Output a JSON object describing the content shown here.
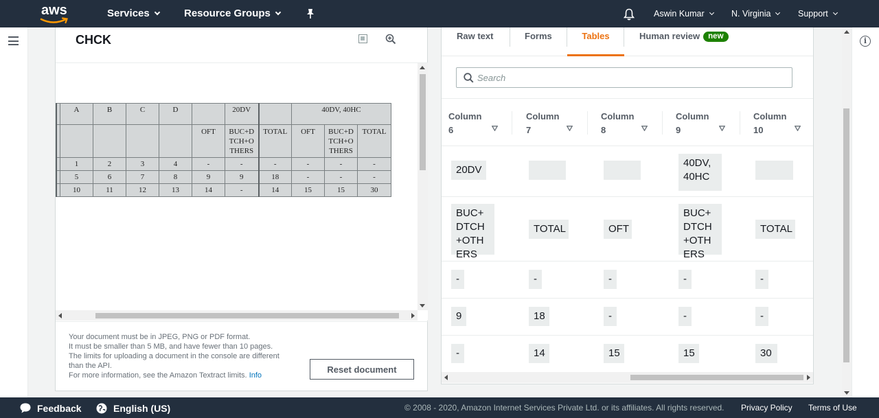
{
  "topnav": {
    "logo": "aws",
    "services": "Services",
    "resource_groups": "Resource Groups",
    "pin_icon": "pin-icon",
    "bell_icon": "bell-icon",
    "user": "Aswin Kumar",
    "region": "N. Virginia",
    "support": "Support"
  },
  "doc": {
    "title": "CHCK",
    "scan_table": {
      "row0": [
        "A",
        "B",
        "C",
        "D",
        "",
        "20DV",
        "",
        "40DV, 40HC"
      ],
      "row1": [
        "",
        "",
        "",
        "",
        "OFT",
        "BUC+D TCH+O THERS",
        "TOTAL",
        "OFT",
        "BUC+D TCH+O THERS",
        "TOTAL"
      ],
      "rows": [
        [
          "1",
          "2",
          "3",
          "4",
          "-",
          "-",
          "-",
          "-",
          "-",
          "-"
        ],
        [
          "5",
          "6",
          "7",
          "8",
          "9",
          "9",
          "18",
          "-",
          "-",
          "-"
        ],
        [
          "10",
          "11",
          "12",
          "13",
          "14",
          "-",
          "14",
          "15",
          "15",
          "30"
        ]
      ]
    },
    "notes": [
      "Your document must be in JPEG, PNG or PDF format.",
      "It must be smaller than 5 MB, and have fewer than 10 pages.",
      "The limits for uploading a document in the console are different than the API.",
      "For more information, see the Amazon Textract limits."
    ],
    "info_link": "Info",
    "reset_button": "Reset document"
  },
  "results": {
    "tabs": [
      "Raw text",
      "Forms",
      "Tables",
      "Human review"
    ],
    "active_tab": "Tables",
    "new_badge": "new",
    "search_placeholder": "Search",
    "columns": [
      "Column 6",
      "Column 7",
      "Column 8",
      "Column 9",
      "Column 10"
    ],
    "rows": [
      [
        "20DV",
        "",
        "",
        "40DV, 40HC",
        ""
      ],
      [
        "BUC+DTCH+OTHERS",
        "TOTAL",
        "OFT",
        "BUC+DTCH+OTHERS",
        "TOTAL"
      ],
      [
        "-",
        "-",
        "-",
        "-",
        "-"
      ],
      [
        "9",
        "18",
        "-",
        "-",
        "-"
      ],
      [
        "-",
        "14",
        "15",
        "15",
        "30"
      ]
    ]
  },
  "footer": {
    "feedback": "Feedback",
    "language": "English (US)",
    "copyright": "© 2008 - 2020, Amazon Internet Services Private Ltd. or its affiliates. All rights reserved.",
    "privacy": "Privacy Policy",
    "terms": "Terms of Use"
  },
  "colors": {
    "nav_bg": "#232f3e",
    "accent": "#ec7211",
    "badge_green": "#1d8102",
    "link": "#0073bb"
  }
}
